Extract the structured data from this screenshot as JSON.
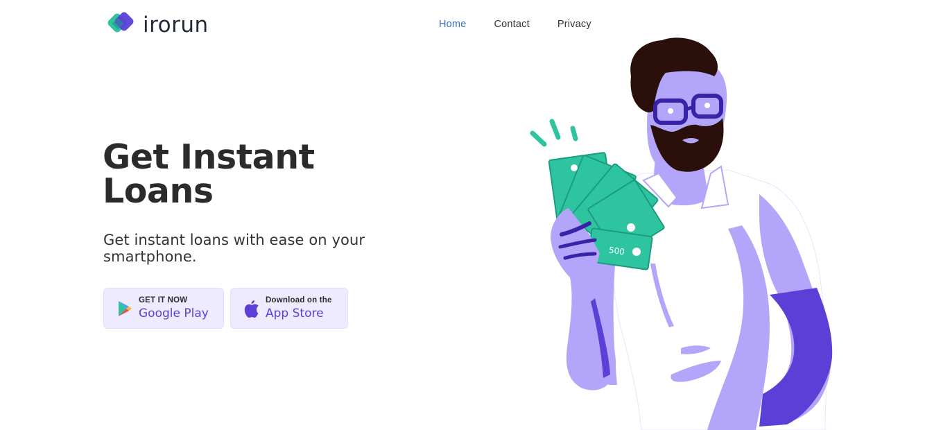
{
  "brand": {
    "name": "irorun",
    "colors": {
      "green": "#2ec4a0",
      "purple": "#5b3fd6",
      "lavender": "#b3a6fa"
    }
  },
  "nav": {
    "items": [
      {
        "label": "Home",
        "active": true
      },
      {
        "label": "Contact",
        "active": false
      },
      {
        "label": "Privacy",
        "active": false
      }
    ]
  },
  "hero": {
    "title_line1": "Get Instant",
    "title_line2": "Loans",
    "subtitle": "Get instant loans with ease on your smartphone."
  },
  "downloads": {
    "google_play": {
      "small": "GET IT NOW",
      "big": "Google Play",
      "icon": "google-play-icon"
    },
    "app_store": {
      "small": "Download on the",
      "big": "App Store",
      "icon": "apple-icon"
    }
  },
  "illustration": {
    "banknote_label": "500"
  }
}
